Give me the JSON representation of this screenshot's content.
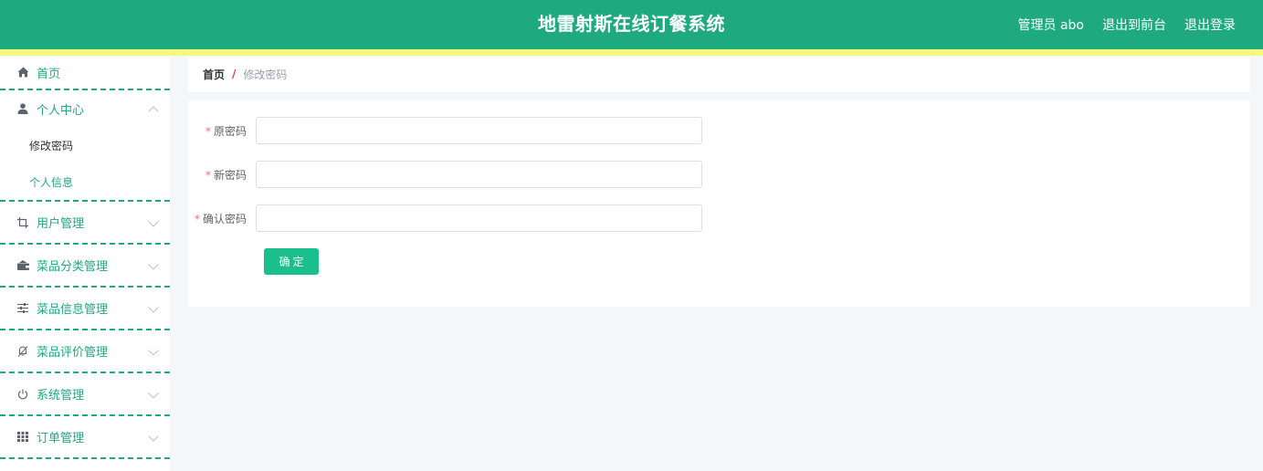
{
  "header": {
    "title": "地雷射斯在线订餐系统",
    "admin_label": "管理员 abo",
    "exit_front": "退出到前台",
    "logout": "退出登录"
  },
  "sidebar": {
    "home": "首页",
    "personal_center": "个人中心",
    "personal_sub": [
      "修改密码",
      "个人信息"
    ],
    "items": [
      "用户管理",
      "菜品分类管理",
      "菜品信息管理",
      "菜品评价管理",
      "系统管理",
      "订单管理"
    ]
  },
  "breadcrumb": {
    "home": "首页",
    "separator": "/",
    "current": "修改密码"
  },
  "form": {
    "old_password_label": "原密码",
    "new_password_label": "新密码",
    "confirm_password_label": "确认密码",
    "required_mark": "*",
    "submit_label": "确定"
  },
  "colors": {
    "primary": "#1eaa7e",
    "strip": "#f6f77c",
    "button": "#1bbf8c"
  }
}
